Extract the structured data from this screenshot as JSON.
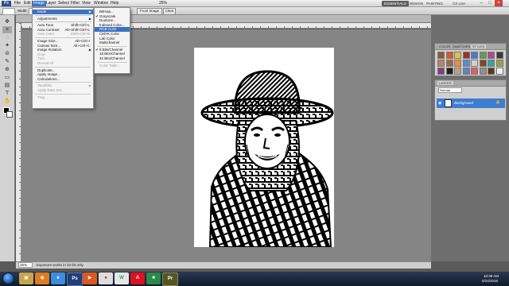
{
  "menubar": {
    "app_logo": "Ps",
    "items": [
      "File",
      "Edit",
      "Image",
      "Layer",
      "Select",
      "Filter",
      "View",
      "Window",
      "Help"
    ],
    "zoom": "25%",
    "workspaces": [
      "ESSENTIALS",
      "DESIGN",
      "PAINTING"
    ],
    "cs_live": "CS Live"
  },
  "options_bar": {
    "width_label": "Width:",
    "front_image_label": "Front Image",
    "clear_label": "Clear"
  },
  "image_menu": {
    "items": [
      {
        "label": "Mode",
        "shortcut": "",
        "state": "highlighted",
        "submenu": true
      },
      {
        "sep": true
      },
      {
        "label": "Adjustments",
        "shortcut": "",
        "state": "normal",
        "submenu": true
      },
      {
        "sep": true
      },
      {
        "label": "Auto Tone",
        "shortcut": "Shift+Ctrl+L",
        "state": "normal"
      },
      {
        "label": "Auto Contrast",
        "shortcut": "Alt+Shift+Ctrl+L",
        "state": "normal"
      },
      {
        "label": "Auto Color",
        "shortcut": "Shift+Ctrl+B",
        "state": "disabled"
      },
      {
        "sep": true
      },
      {
        "label": "Image Size...",
        "shortcut": "Alt+Ctrl+I",
        "state": "normal"
      },
      {
        "label": "Canvas Size...",
        "shortcut": "Alt+Ctrl+C",
        "state": "normal"
      },
      {
        "label": "Image Rotation",
        "shortcut": "",
        "state": "normal",
        "submenu": true
      },
      {
        "label": "Crop",
        "shortcut": "",
        "state": "disabled"
      },
      {
        "label": "Trim...",
        "shortcut": "",
        "state": "disabled"
      },
      {
        "label": "Reveal All",
        "shortcut": "",
        "state": "disabled"
      },
      {
        "sep": true
      },
      {
        "label": "Duplicate...",
        "shortcut": "",
        "state": "normal"
      },
      {
        "label": "Apply Image...",
        "shortcut": "",
        "state": "normal"
      },
      {
        "label": "Calculations...",
        "shortcut": "",
        "state": "normal"
      },
      {
        "sep": true
      },
      {
        "label": "Variables",
        "shortcut": "",
        "state": "disabled",
        "submenu": true
      },
      {
        "label": "Apply Data Set...",
        "shortcut": "",
        "state": "disabled"
      },
      {
        "sep": true
      },
      {
        "label": "Trap...",
        "shortcut": "",
        "state": "disabled"
      }
    ]
  },
  "mode_submenu": {
    "items": [
      {
        "label": "Bitmap...",
        "state": "normal"
      },
      {
        "label": "Grayscale",
        "state": "checked"
      },
      {
        "label": "Duotone...",
        "state": "normal"
      },
      {
        "label": "Indexed Color...",
        "state": "normal"
      },
      {
        "label": "RGB Color",
        "state": "highlighted"
      },
      {
        "label": "CMYK Color",
        "state": "normal"
      },
      {
        "label": "Lab Color",
        "state": "normal"
      },
      {
        "label": "Multichannel",
        "state": "normal"
      },
      {
        "sep": true
      },
      {
        "label": "8 Bits/Channel",
        "state": "checked"
      },
      {
        "label": "16 Bits/Channel",
        "state": "normal"
      },
      {
        "label": "32 Bits/Channel",
        "state": "normal"
      },
      {
        "sep": true
      },
      {
        "label": "Color Table...",
        "state": "disabled"
      }
    ]
  },
  "swatches_panel": {
    "tabs": [
      "COLOR",
      "SWATCHES",
      "STYLES"
    ]
  },
  "layers_panel": {
    "tabs": [
      "LAYERS"
    ],
    "blend_mode": "Normal",
    "layer_name": "Background"
  },
  "status_bar": {
    "zoom": "25%",
    "doc_info": "Exposure works in 32-bit only"
  },
  "taskbar": {
    "time": "10:39 AM",
    "date": "5/24/2016"
  }
}
